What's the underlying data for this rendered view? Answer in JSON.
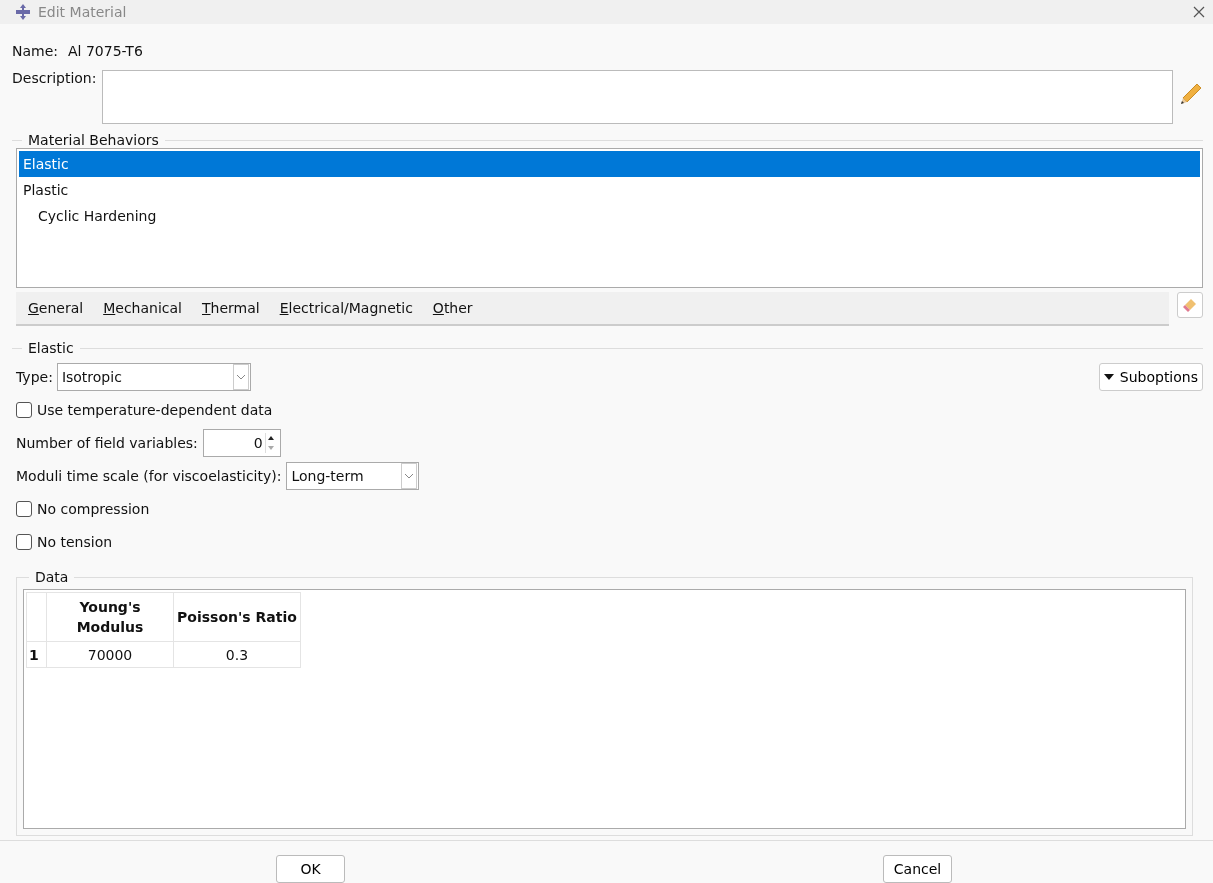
{
  "window": {
    "title": "Edit Material"
  },
  "name": {
    "label": "Name:",
    "value": "Al 7075-T6"
  },
  "description": {
    "label": "Description:"
  },
  "behaviors": {
    "title": "Material Behaviors",
    "items": [
      {
        "label": "Elastic",
        "selected": true
      },
      {
        "label": "Plastic",
        "selected": false,
        "children": [
          {
            "label": "Cyclic Hardening",
            "selected": false
          }
        ]
      }
    ]
  },
  "menu": [
    {
      "label": "General",
      "mnemonic": true
    },
    {
      "label": "Mechanical",
      "mnemonic": true
    },
    {
      "label": "Thermal",
      "mnemonic": true
    },
    {
      "label": "Electrical/Magnetic",
      "mnemonic": true
    },
    {
      "label": "Other",
      "mnemonic": true
    }
  ],
  "elastic": {
    "title": "Elastic",
    "type": {
      "label": "Type:",
      "value": "Isotropic"
    },
    "suboptions": "Suboptions",
    "options": [
      {
        "kind": "checkbox",
        "label": "Use temperature-dependent data",
        "checked": false
      },
      {
        "kind": "spinner",
        "label": "Number of field variables:",
        "value": "0"
      },
      {
        "kind": "select",
        "label": "Moduli time scale (for viscoelasticity):",
        "value": "Long-term"
      },
      {
        "kind": "checkbox",
        "label": "No compression",
        "checked": false
      },
      {
        "kind": "checkbox",
        "label": "No tension",
        "checked": false
      }
    ],
    "data": {
      "title": "Data",
      "columns": [
        "Young's Modulus",
        "Poisson's Ratio"
      ],
      "rows": [
        {
          "index": "1",
          "cells": [
            "70000",
            "0.3"
          ]
        }
      ]
    }
  },
  "buttons": [
    {
      "label": "OK"
    },
    {
      "label": "Cancel"
    }
  ]
}
